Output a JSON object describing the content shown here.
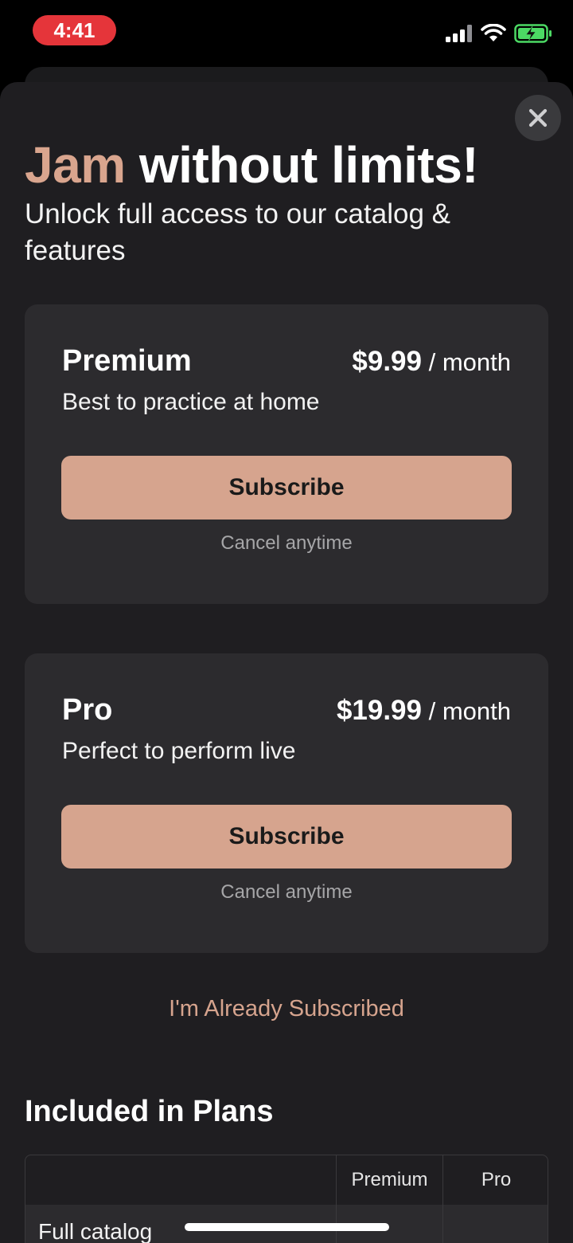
{
  "status_bar": {
    "time": "4:41",
    "icons": [
      "cellular-signal-icon",
      "wifi-icon",
      "battery-charging-icon"
    ],
    "time_pill_color": "#e5353a",
    "battery_color": "#4cd964"
  },
  "header": {
    "title_accent": "Jam",
    "title_rest": " without limits!",
    "subtitle": "Unlock full access to our catalog & features",
    "accent_color": "#d9a58e",
    "close_icon": "close-icon"
  },
  "plans": [
    {
      "name": "Premium",
      "price": "$9.99",
      "period": " / month",
      "description": "Best to practice at home",
      "cta": "Subscribe",
      "note": "Cancel anytime"
    },
    {
      "name": "Pro",
      "price": "$19.99",
      "period": " / month",
      "description": "Perfect to perform live",
      "cta": "Subscribe",
      "note": "Cancel anytime"
    }
  ],
  "already_subscribed": "I'm Already Subscribed",
  "included": {
    "title": "Included in Plans",
    "columns": [
      "",
      "Premium",
      "Pro"
    ],
    "rows": [
      {
        "feature": "Full catalog",
        "premium": "",
        "pro": ""
      }
    ]
  },
  "colors": {
    "cta_background": "#d6a48e",
    "card_background": "#2c2b2e",
    "sheet_background": "#1f1e21"
  }
}
